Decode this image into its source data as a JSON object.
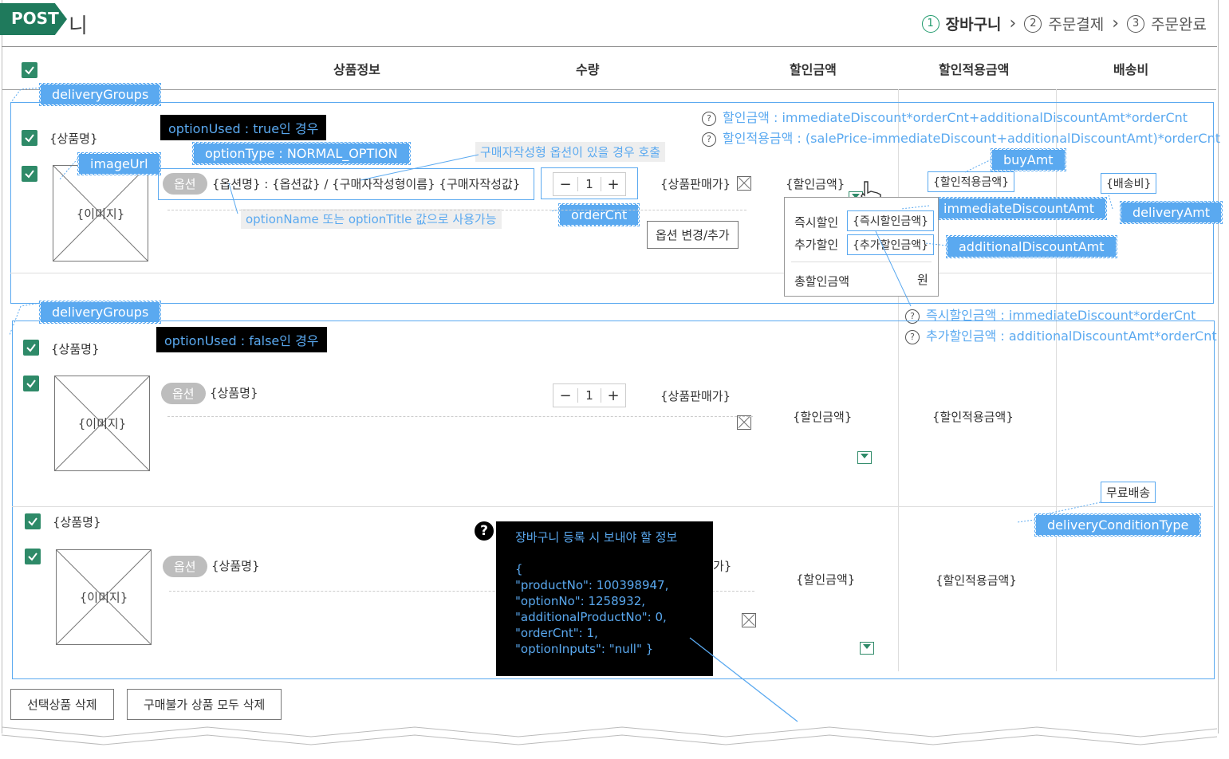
{
  "header": {
    "badge": "POST",
    "title": "장바구니",
    "title_visible": "니",
    "steps": [
      {
        "num": "1",
        "label": "장바구니"
      },
      {
        "num": "2",
        "label": "주문결제"
      },
      {
        "num": "3",
        "label": "주문완료"
      }
    ]
  },
  "table_head": {
    "product_info": "상품정보",
    "quantity": "수량",
    "discount": "할인금액",
    "discounted_amount": "할인적용금액",
    "shipping": "배송비"
  },
  "notes": {
    "delivery_groups": "deliveryGroups",
    "image_url": "imageUrl",
    "option_used_true": "optionUsed : true인 경우",
    "option_used_false": "optionUsed : false인 경우",
    "option_type": "optionType : NORMAL_OPTION",
    "custom_option_call": "구매자작성형 옵션이 있을 경우 호출",
    "option_name_note": "optionName 또는 optionTitle 값으로 사용가능",
    "order_cnt": "orderCnt",
    "buy_amt": "buyAmt",
    "immediate_discount_amt": "immediateDiscountAmt",
    "additional_discount_amt": "additionalDiscountAmt",
    "delivery_amt": "deliveryAmt",
    "delivery_condition_type": "deliveryConditionType",
    "formula_discount": "할인금액 : immediateDiscount*orderCnt+additionalDiscountAmt*orderCnt",
    "formula_applied": "할인적용금액 : (salePrice-immediateDiscount+additionalDiscountAmt)*orderCnt",
    "formula_immediate": "즉시할인금액 : immediateDiscount*orderCnt",
    "formula_additional": "추가할인금액 : additionalDiscountAmt*orderCnt"
  },
  "group1": {
    "product_name": "{상품명}",
    "image": "{이미지}",
    "option_label": "옵션",
    "option_text": "{옵션명} : {옵션값} / {구매자작성형이름} {구매자작성값}",
    "qty_minus": "−",
    "qty_value": "1",
    "qty_plus": "+",
    "sale_price": "{상품판매가}",
    "discount": "{할인금액}",
    "applied": "{할인적용금액}",
    "shipping": "{배송비}",
    "change_option": "옵션 변경/추가",
    "popup": {
      "immediate_label": "즉시할인",
      "immediate_value": "{즉시할인금액}",
      "additional_label": "추가할인",
      "additional_value": "{추가할인금액}",
      "total_label": "총할인금액",
      "total_unit": "원"
    }
  },
  "group2": {
    "product_name": "{상품명}",
    "image": "{이미지}",
    "option_label": "옵션",
    "option_text": "{상품명}",
    "qty_minus": "−",
    "qty_value": "1",
    "qty_plus": "+",
    "sale_price": "{상품판매가}",
    "discount": "{할인금액}",
    "applied": "{할인적용금액}"
  },
  "group3": {
    "product_name": "{상품명}",
    "image": "{이미지}",
    "option_label": "옵션",
    "option_text": "{상품명}",
    "sale_price_partial": "가}",
    "discount": "{할인금액}",
    "applied": "{할인적용금액}",
    "free_shipping": "무료배송"
  },
  "json_info": {
    "title": "장바구니 등록 시 보내야 할 정보",
    "body": "{\n\"productNo\": 100398947,\n\"optionNo\": 1258932,\n\"additionalProductNo\": 0,\n\"orderCnt\": 1,\n\"optionInputs\": \"null\" }"
  },
  "footer": {
    "delete_selected": "선택상품 삭제",
    "delete_unavailable": "구매불가 상품 모두 삭제"
  },
  "colors": {
    "accent_green": "#2e8a68",
    "note_blue": "#5aa9f0",
    "post_green": "#1f7a5c"
  }
}
